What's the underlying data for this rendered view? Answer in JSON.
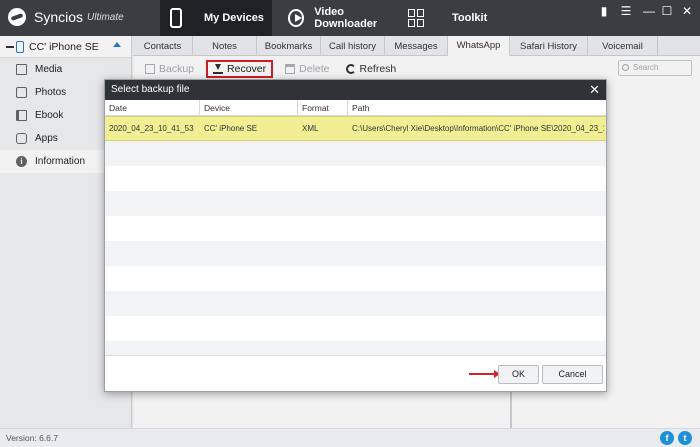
{
  "app": {
    "name": "Syncios",
    "edition": "Ultimate"
  },
  "topnav": [
    {
      "label": "My Devices",
      "icon": "phone-icon",
      "active": true
    },
    {
      "label": "Video Downloader",
      "icon": "play-icon",
      "active": false
    },
    {
      "label": "Toolkit",
      "icon": "toolkit-icon",
      "active": false
    }
  ],
  "window_controls": [
    "chat-icon",
    "menu-icon",
    "minimize-icon",
    "maximize-icon",
    "close-icon"
  ],
  "sidebar": {
    "device_name": "CC' iPhone SE",
    "items": [
      {
        "label": "Media",
        "icon": "media-icon"
      },
      {
        "label": "Photos",
        "icon": "photos-icon"
      },
      {
        "label": "Ebook",
        "icon": "ebook-icon"
      },
      {
        "label": "Apps",
        "icon": "apps-icon"
      },
      {
        "label": "Information",
        "icon": "information-icon",
        "active": true
      }
    ]
  },
  "subtabs": [
    {
      "label": "Contacts"
    },
    {
      "label": "Notes"
    },
    {
      "label": "Bookmarks"
    },
    {
      "label": "Call history"
    },
    {
      "label": "Messages"
    },
    {
      "label": "WhatsApp",
      "active": true
    },
    {
      "label": "Safari History"
    },
    {
      "label": "Voicemail"
    }
  ],
  "toolbar": {
    "backup_label": "Backup",
    "recover_label": "Recover",
    "delete_label": "Delete",
    "refresh_label": "Refresh",
    "search_placeholder": "Search"
  },
  "dialog": {
    "title": "Select backup file",
    "columns": [
      "Date",
      "Device",
      "Format",
      "Path"
    ],
    "rows": [
      {
        "date": "2020_04_23_10_41_53",
        "device": "CC' iPhone SE",
        "format": "XML",
        "path": "C:\\Users\\Cheryl Xie\\Desktop\\Information\\CC' iPhone SE\\2020_04_23_10...",
        "selected": true
      }
    ],
    "ok_label": "OK",
    "cancel_label": "Cancel"
  },
  "status": {
    "version": "Version: 6.6.7"
  },
  "colors": {
    "topbar": "#3a3d42",
    "highlight_row": "#f1ee94",
    "accent_red": "#d9212a",
    "social_blue": "#1e90d8"
  }
}
